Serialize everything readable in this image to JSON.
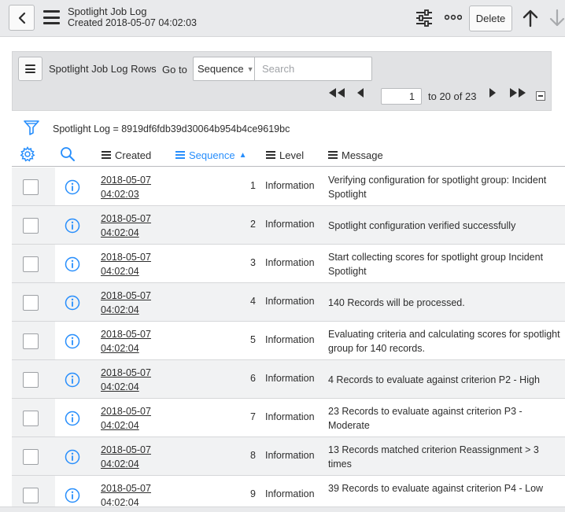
{
  "header": {
    "title": "Spotlight Job Log",
    "subtitle": "Created 2018-05-07 04:02:03",
    "delete_label": "Delete"
  },
  "list": {
    "title": "Spotlight Job Log Rows",
    "goto_label": "Go to",
    "goto_field": "Sequence",
    "search_placeholder": "Search",
    "page_value": "1",
    "page_range": "to 20 of 23"
  },
  "filter": {
    "text": "Spotlight Log = 8919df6fdb39d30064b954b4ce9619bc"
  },
  "columns": {
    "created": "Created",
    "sequence": "Sequence",
    "level": "Level",
    "message": "Message"
  },
  "rows": [
    {
      "date": "2018-05-07",
      "time": "04:02:03",
      "seq": "1",
      "level": "Information",
      "message": "Verifying configuration for spotlight group: Incident Spotlight"
    },
    {
      "date": "2018-05-07",
      "time": "04:02:04",
      "seq": "2",
      "level": "Information",
      "message": "Spotlight configuration verified successfully"
    },
    {
      "date": "2018-05-07",
      "time": "04:02:04",
      "seq": "3",
      "level": "Information",
      "message": "Start collecting scores for spotlight group Incident Spotlight"
    },
    {
      "date": "2018-05-07",
      "time": "04:02:04",
      "seq": "4",
      "level": "Information",
      "message": "140 Records will be processed."
    },
    {
      "date": "2018-05-07",
      "time": "04:02:04",
      "seq": "5",
      "level": "Information",
      "message": "Evaluating criteria and calculating scores for spotlight group for 140 records."
    },
    {
      "date": "2018-05-07",
      "time": "04:02:04",
      "seq": "6",
      "level": "Information",
      "message": "4 Records to evaluate against criterion P2 - High"
    },
    {
      "date": "2018-05-07",
      "time": "04:02:04",
      "seq": "7",
      "level": "Information",
      "message": "23 Records to evaluate against criterion P3 - Moderate"
    },
    {
      "date": "2018-05-07",
      "time": "04:02:04",
      "seq": "8",
      "level": "Information",
      "message": "13 Records matched criterion Reassignment > 3 times"
    },
    {
      "date": "2018-05-07",
      "time": "04:02:04",
      "seq": "9",
      "level": "Information",
      "message": "39 Records to evaluate against criterion P4 - Low"
    }
  ],
  "colors": {
    "accent": "#278efc",
    "header_bg": "#e9eaec",
    "panel_bg": "#e1e2e4",
    "row_alt": "#f1f2f3"
  },
  "icons": {
    "back": "chevron-left-icon",
    "menu": "hamburger-icon",
    "personalize": "sliders-icon",
    "more": "more-options-icon",
    "prev_record": "arrow-up-icon",
    "next_record": "arrow-down-icon",
    "filter": "funnel-icon",
    "settings": "gear-icon",
    "search": "search-icon",
    "info": "info-icon"
  }
}
